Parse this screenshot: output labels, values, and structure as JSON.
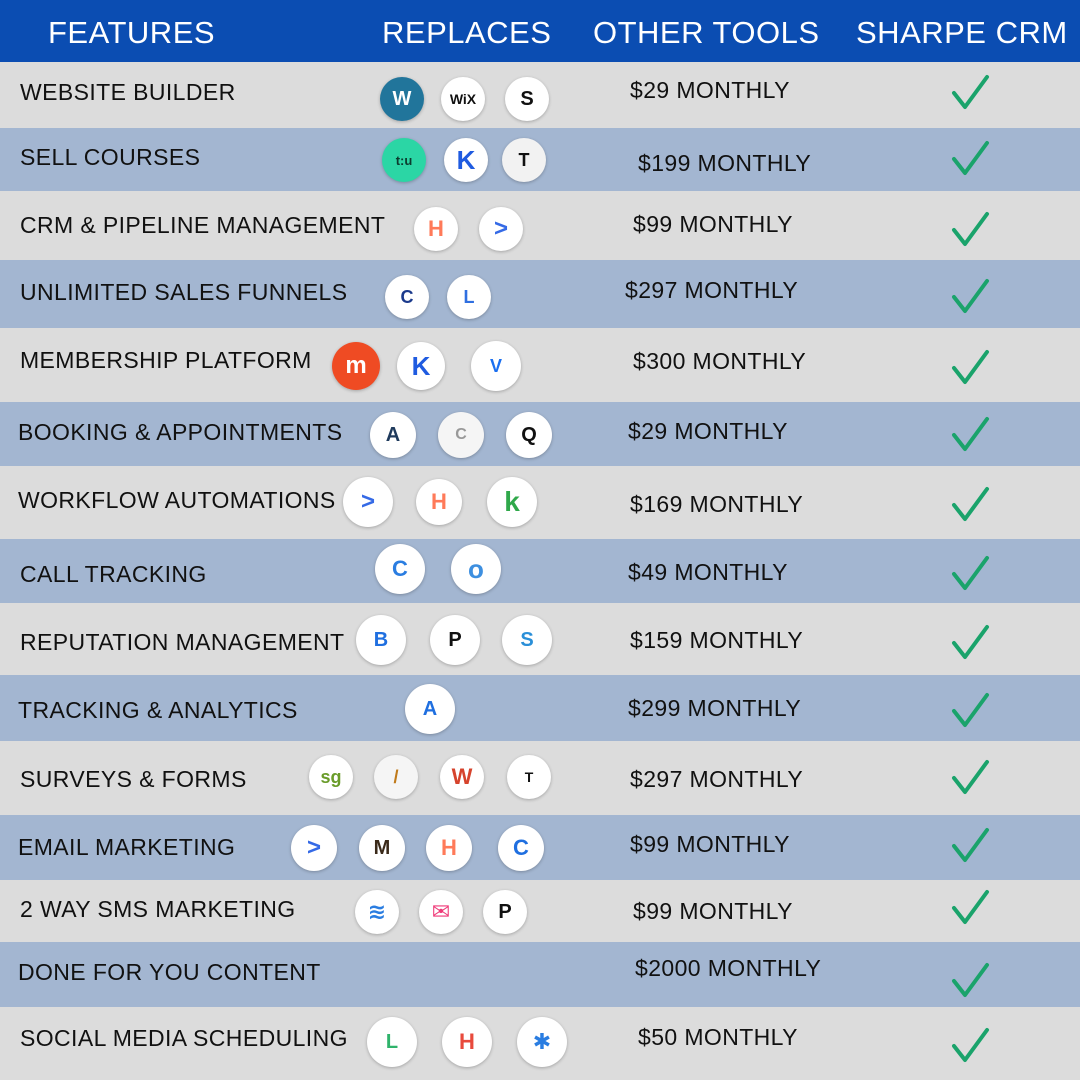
{
  "header": {
    "features": "FEATURES",
    "replaces": "REPLACES",
    "other_tools": "OTHER TOOLS",
    "brand": "SHARPE CRM"
  },
  "colors": {
    "header_bg": "#0b4db2",
    "row_light": "#dcdcdc",
    "row_dark": "#a3b6d1",
    "check": "#1aa36b"
  },
  "rows": [
    {
      "feature": "WEBSITE BUILDER",
      "price": "$29 MONTHLY",
      "logos": [
        {
          "icon": "wordpress-icon",
          "text": "W"
        },
        {
          "icon": "wix-icon",
          "text": "WiX"
        },
        {
          "icon": "squarespace-icon",
          "text": "S"
        }
      ]
    },
    {
      "feature": "SELL COURSES",
      "price": "$199 MONTHLY",
      "logos": [
        {
          "icon": "teachable-icon",
          "text": "t:u"
        },
        {
          "icon": "kajabi-icon",
          "text": "K"
        },
        {
          "icon": "thinkific-icon",
          "text": "T"
        }
      ]
    },
    {
      "feature": "CRM & PIPELINE MANAGEMENT",
      "price": "$99 MONTHLY",
      "logos": [
        {
          "icon": "hubspot-icon",
          "text": "H"
        },
        {
          "icon": "activecampaign-icon",
          "text": ">"
        }
      ]
    },
    {
      "feature": "UNLIMITED SALES FUNNELS",
      "price": "$297 MONTHLY",
      "logos": [
        {
          "icon": "clickfunnels-icon",
          "text": "C"
        },
        {
          "icon": "leadpages-icon",
          "text": "L"
        }
      ]
    },
    {
      "feature": "MEMBERSHIP PLATFORM",
      "price": "$300 MONTHLY",
      "logos": [
        {
          "icon": "memberpress-icon",
          "text": "m"
        },
        {
          "icon": "kajabi-icon",
          "text": "K"
        },
        {
          "icon": "video-icon",
          "text": "V"
        }
      ]
    },
    {
      "feature": "BOOKING & APPOINTMENTS",
      "price": "$29 MONTHLY",
      "logos": [
        {
          "icon": "acuity-icon",
          "text": "A"
        },
        {
          "icon": "calendar-icon",
          "text": "C"
        },
        {
          "icon": "q-icon",
          "text": "Q"
        }
      ]
    },
    {
      "feature": "WORKFLOW AUTOMATIONS",
      "price": "$169 MONTHLY",
      "logos": [
        {
          "icon": "activecampaign-icon",
          "text": ">"
        },
        {
          "icon": "hubspot-icon",
          "text": "H"
        },
        {
          "icon": "keap-icon",
          "text": "k"
        }
      ]
    },
    {
      "feature": "CALL TRACKING",
      "price": "$49 MONTHLY",
      "logos": [
        {
          "icon": "callrail-icon",
          "text": "C"
        },
        {
          "icon": "phone-ring-icon",
          "text": "o"
        }
      ]
    },
    {
      "feature": "REPUTATION MANAGEMENT",
      "price": "$159 MONTHLY",
      "logos": [
        {
          "icon": "birdeye-icon",
          "text": "B"
        },
        {
          "icon": "podium-icon",
          "text": "P"
        },
        {
          "icon": "swell-icon",
          "text": "S"
        }
      ]
    },
    {
      "feature": "TRACKING & ANALYTICS",
      "price": "$299 MONTHLY",
      "logos": [
        {
          "icon": "analytics-icon",
          "text": "A"
        }
      ]
    },
    {
      "feature": "SURVEYS & FORMS",
      "price": "$297 MONTHLY",
      "logos": [
        {
          "icon": "surveygizmo-icon",
          "text": "sg"
        },
        {
          "icon": "pen-icon",
          "text": "/"
        },
        {
          "icon": "wufoo-icon",
          "text": "W"
        },
        {
          "icon": "typeform-icon",
          "text": "T"
        }
      ]
    },
    {
      "feature": "EMAIL MARKETING",
      "price": "$99 MONTHLY",
      "logos": [
        {
          "icon": "activecampaign-icon",
          "text": ">"
        },
        {
          "icon": "mailchimp-icon",
          "text": "M"
        },
        {
          "icon": "hubspot-icon",
          "text": "H"
        },
        {
          "icon": "constant-contact-icon",
          "text": "C"
        }
      ]
    },
    {
      "feature": "2 WAY SMS MARKETING",
      "price": "$99 MONTHLY",
      "logos": [
        {
          "icon": "layers-icon",
          "text": "≋"
        },
        {
          "icon": "envelope-icon",
          "text": "✉"
        },
        {
          "icon": "podium-icon",
          "text": "P"
        }
      ]
    },
    {
      "feature": "DONE FOR YOU CONTENT",
      "price": "$2000 MONTHLY",
      "logos": []
    },
    {
      "feature": "SOCIAL MEDIA SCHEDULING",
      "price": "$50 MONTHLY",
      "logos": [
        {
          "icon": "later-icon",
          "text": "L"
        },
        {
          "icon": "hootsuite-icon",
          "text": "H"
        },
        {
          "icon": "sprout-icon",
          "text": "✱"
        }
      ]
    }
  ]
}
